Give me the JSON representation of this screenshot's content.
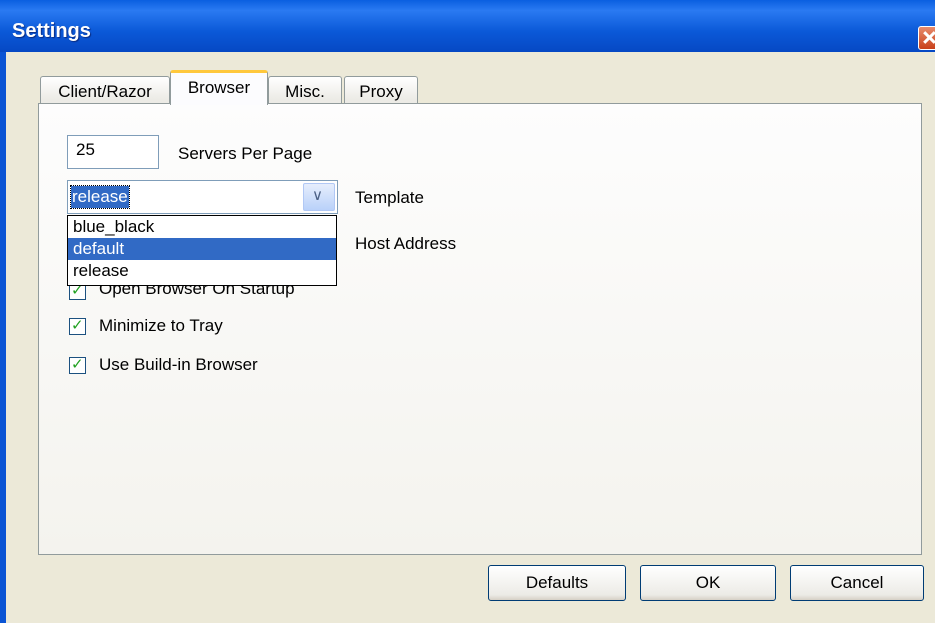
{
  "window": {
    "title": "Settings"
  },
  "tabs": [
    {
      "label": "Client/Razor",
      "active": false
    },
    {
      "label": "Browser",
      "active": true
    },
    {
      "label": "Misc.",
      "active": false
    },
    {
      "label": "Proxy",
      "active": false
    }
  ],
  "browser": {
    "servers_per_page": {
      "value": "25",
      "label": "Servers Per Page"
    },
    "template": {
      "selected": "release",
      "label": "Template",
      "options": [
        "blue_black",
        "default",
        "release"
      ],
      "highlighted_option": "default"
    },
    "host_address": {
      "label": "Host Address"
    },
    "checkboxes": [
      {
        "label": "Open Browser On Startup",
        "checked": true
      },
      {
        "label": "Minimize to Tray",
        "checked": true
      },
      {
        "label": "Use Build-in Browser",
        "checked": true
      }
    ]
  },
  "buttons": {
    "defaults": "Defaults",
    "ok": "OK",
    "cancel": "Cancel"
  },
  "colors": {
    "titlebar": "#0a5fe0",
    "selection": "#316ac5",
    "dialog_bg": "#ece9d8"
  }
}
